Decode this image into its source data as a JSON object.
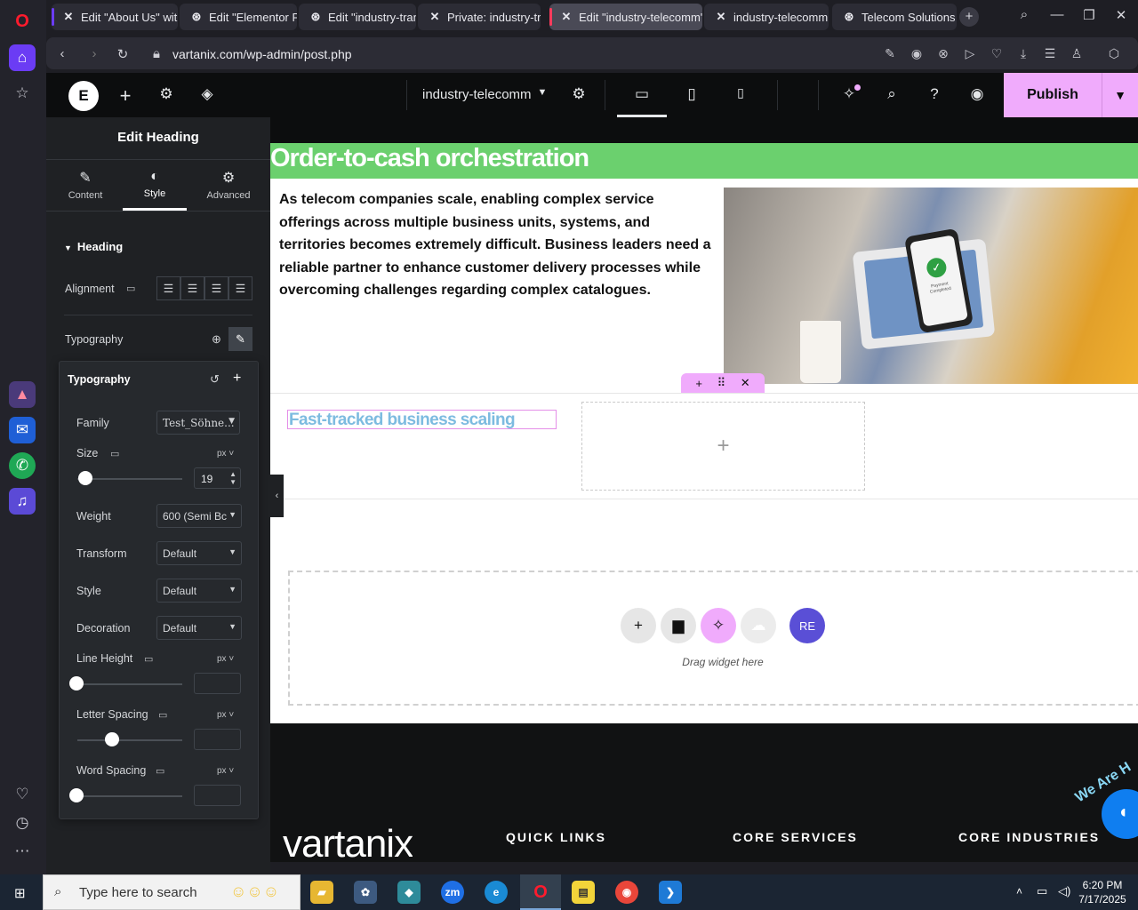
{
  "browser": {
    "tabs": [
      {
        "label": "Edit \"About Us\" with",
        "icon": "elementor-x-icon"
      },
      {
        "label": "Edit \"Elementor Pag",
        "icon": "wordpress-icon"
      },
      {
        "label": "Edit \"industry-transp",
        "icon": "wordpress-icon"
      },
      {
        "label": "Private: industry-tra",
        "icon": "elementor-x-icon"
      },
      {
        "label": "Edit \"industry-telecomm\"",
        "icon": "elementor-x-icon"
      },
      {
        "label": "industry-telecomm",
        "icon": "elementor-x-icon"
      },
      {
        "label": "Telecom Solutions -",
        "icon": "wordpress-icon"
      }
    ],
    "url": "vartanix.com/wp-admin/post.php"
  },
  "topbar": {
    "page_name": "industry-telecomm",
    "publish_label": "Publish"
  },
  "panel": {
    "title": "Edit Heading",
    "tabs": [
      {
        "label": "Content",
        "icon": "pencil-icon"
      },
      {
        "label": "Style",
        "icon": "half-circle-icon"
      },
      {
        "label": "Advanced",
        "icon": "gear-icon"
      }
    ],
    "section_title": "Heading",
    "alignment_label": "Alignment",
    "typography_label": "Typography",
    "popover": {
      "title": "Typography",
      "family_label": "Family",
      "family_value": "Test_Söhne...",
      "size_label": "Size",
      "size_unit": "px",
      "size_value": "19",
      "weight_label": "Weight",
      "weight_value": "600 (Semi Bc",
      "transform_label": "Transform",
      "transform_value": "Default",
      "style_label": "Style",
      "style_value": "Default",
      "decoration_label": "Decoration",
      "decoration_value": "Default",
      "line_height_label": "Line Height",
      "line_height_unit": "px",
      "letter_spacing_label": "Letter Spacing",
      "letter_spacing_unit": "px",
      "word_spacing_label": "Word Spacing",
      "word_spacing_unit": "px"
    }
  },
  "canvas": {
    "main_heading": "Order-to-cash orchestration",
    "paragraph": "As telecom companies scale, enabling complex service offerings across multiple business units, systems, and territories becomes extremely difficult. Business leaders need a reliable partner to enhance customer delivery processes while overcoming challenges regarding complex catalogues.",
    "selected_heading": "Fast-tracked business scaling",
    "drag_text": "Drag widget here",
    "footer": {
      "brand": "vartanix",
      "col1": "QUICK LINKS",
      "col2": "CORE SERVICES",
      "col3": "CORE INDUSTRIES",
      "chat_badge": "We Are H"
    },
    "phone_screen_text": "Payment Completed"
  },
  "taskbar": {
    "search_placeholder": "Type here to search",
    "time": "6:20 PM",
    "date": "7/17/2025"
  },
  "colors": {
    "publish": "#f0abfc",
    "green_banner": "#6bd06e",
    "selected_heading": "#7dbbe0"
  }
}
